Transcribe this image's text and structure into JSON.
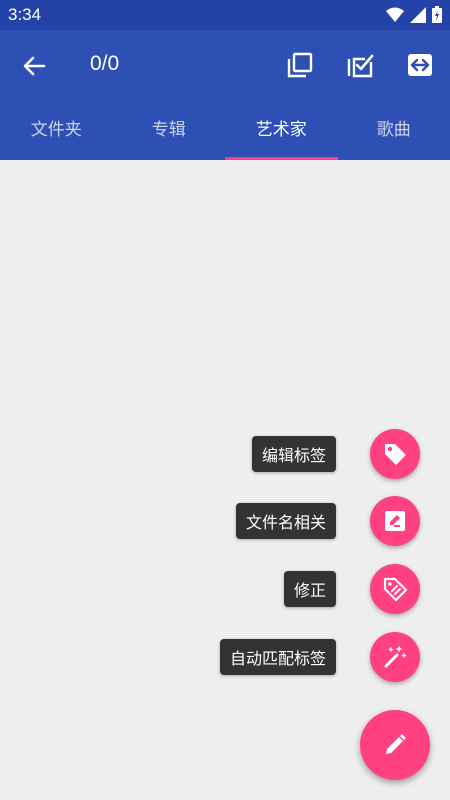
{
  "status_bar": {
    "time": "3:34"
  },
  "app_bar": {
    "counter": "0/0"
  },
  "tabs": [
    {
      "label": "文件夹",
      "active": false
    },
    {
      "label": "专辑",
      "active": false
    },
    {
      "label": "艺术家",
      "active": true
    },
    {
      "label": "歌曲",
      "active": false
    }
  ],
  "fab_menu": {
    "items": [
      {
        "label": "编辑标签",
        "icon": "tag-icon"
      },
      {
        "label": "文件名相关",
        "icon": "edit-box-icon"
      },
      {
        "label": "修正",
        "icon": "tag-fix-icon"
      },
      {
        "label": "自动匹配标签",
        "icon": "magic-wand-icon"
      }
    ],
    "main_icon": "pencil-icon"
  },
  "colors": {
    "primary": "#2e4fb4",
    "status_bar": "#2443a8",
    "accent": "#ff4081",
    "background": "#eeeeee"
  }
}
